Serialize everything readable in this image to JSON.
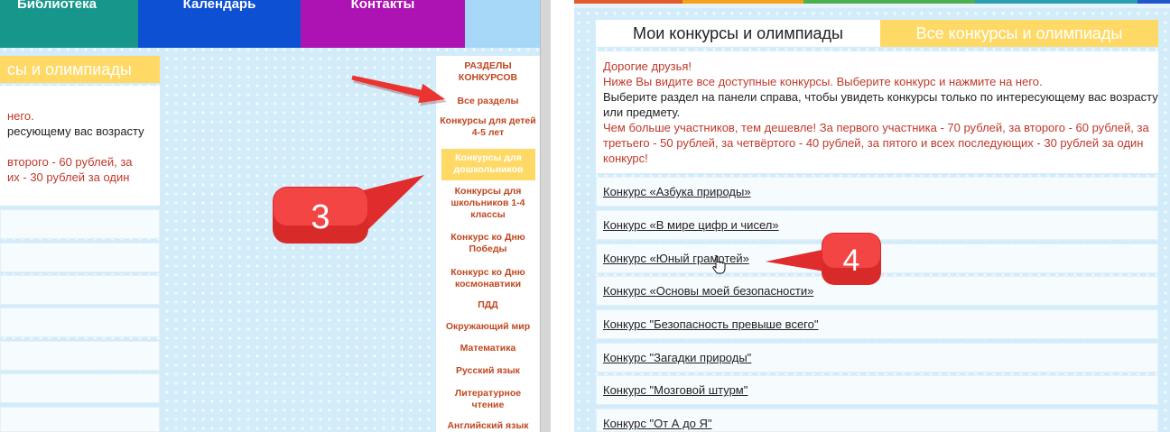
{
  "colors": {
    "accent_red": "#c0392b",
    "text_dark": "#222222",
    "tab_yellow": "#ffd966",
    "sidebar_text": "#c0471f",
    "callout_red": "#e8302e",
    "page_bg": "#d3ecfa"
  },
  "left_panel": {
    "nav": {
      "items": [
        {
          "label": "Библиотека",
          "color": "#17978b"
        },
        {
          "label": "Календарь",
          "color": "#0d50d2"
        },
        {
          "label": "Контакты",
          "color": "#ad12b2"
        }
      ],
      "spare_color": "#a6d7f6"
    },
    "all_tab_label": "сы и олимпиады",
    "info_lines": [
      {
        "text": "него.",
        "color": "#c0392b"
      },
      {
        "text": "ресующему вас возрасту",
        "color": "#222222"
      },
      {
        "text": "второго - 60 рублей, за",
        "color": "#c0392b"
      },
      {
        "text": "их - 30 рублей за один",
        "color": "#c0392b"
      }
    ],
    "sidebar": {
      "title": [
        "РАЗДЕЛЫ",
        "КОНКУРСОВ"
      ],
      "active_index": 2,
      "items": [
        {
          "lines": [
            "Все разделы"
          ]
        },
        {
          "lines": [
            "Конкурсы для детей",
            "4-5 лет"
          ]
        },
        {
          "lines": [
            "Конкурсы для",
            "дошкольников"
          ]
        },
        {
          "lines": [
            "Конкурсы для",
            "школьников 1-4",
            "классы"
          ]
        },
        {
          "lines": [
            "Конкурс ко Дню",
            "Победы"
          ]
        },
        {
          "lines": [
            "Конкурс ко Дню",
            "космонавтики"
          ]
        },
        {
          "lines": [
            "ПДД"
          ]
        },
        {
          "lines": [
            "Окружающий мир"
          ]
        },
        {
          "lines": [
            "Математика"
          ]
        },
        {
          "lines": [
            "Русский язык"
          ]
        },
        {
          "lines": [
            "Литературное",
            "чтение"
          ]
        },
        {
          "lines": [
            "Английский язык"
          ]
        }
      ]
    },
    "callout": {
      "label": "3",
      "pointer_icon": "red-arrow-icon"
    }
  },
  "right_panel": {
    "tabs": [
      {
        "label": "Мои конкурсы и олимпиады",
        "active": true
      },
      {
        "label": "Все конкурсы и олимпиады",
        "active": false
      }
    ],
    "info_lines": [
      {
        "text": "Дорогие друзья!",
        "color": "#c0392b"
      },
      {
        "text": "Ниже Вы видите все доступные конкурсы. Выберите конкурс и нажмите на него.",
        "color": "#c0392b"
      },
      {
        "text": "Выберите раздел на панели справа, чтобы увидеть конкурсы только по интересующему вас возрасту",
        "color": "#222222"
      },
      {
        "text": "или предмету.",
        "color": "#222222"
      },
      {
        "text": "Чем больше участников, тем дешевле! За первого участника - 70 рублей, за второго - 60 рублей, за",
        "color": "#c0392b"
      },
      {
        "text": "третьего - 50 рублей, за четвёртого - 40 рублей, за пятого и всех последующих - 30 рублей за один",
        "color": "#c0392b"
      },
      {
        "text": "конкурс!",
        "color": "#c0392b"
      }
    ],
    "contests": [
      "Конкурс «Азбука природы»",
      "Конкурс «В мире цифр и чисел»",
      "Конкурс «Юный грамотей»",
      "Конкурс «Основы моей безопасности»",
      "Конкурс \"Безопасность превыше всего\"",
      "Конкурс \"Загадки природы\"",
      "Конкурс \"Мозговой штурм\"",
      "Конкурс \"От А до Я\""
    ],
    "hovered_index": 2,
    "cursor_icon": "hand-cursor-icon",
    "callout": {
      "label": "4"
    }
  }
}
